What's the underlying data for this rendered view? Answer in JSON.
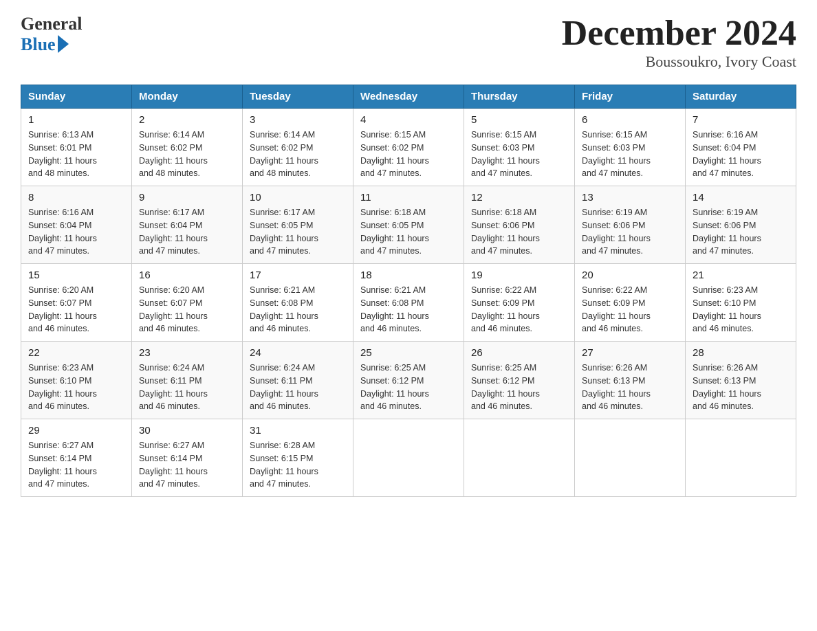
{
  "header": {
    "logo_general": "General",
    "logo_blue": "Blue",
    "month_title": "December 2024",
    "location": "Boussoukro, Ivory Coast"
  },
  "days_of_week": [
    "Sunday",
    "Monday",
    "Tuesday",
    "Wednesday",
    "Thursday",
    "Friday",
    "Saturday"
  ],
  "weeks": [
    [
      {
        "day": "1",
        "sunrise": "6:13 AM",
        "sunset": "6:01 PM",
        "daylight": "11 hours and 48 minutes."
      },
      {
        "day": "2",
        "sunrise": "6:14 AM",
        "sunset": "6:02 PM",
        "daylight": "11 hours and 48 minutes."
      },
      {
        "day": "3",
        "sunrise": "6:14 AM",
        "sunset": "6:02 PM",
        "daylight": "11 hours and 48 minutes."
      },
      {
        "day": "4",
        "sunrise": "6:15 AM",
        "sunset": "6:02 PM",
        "daylight": "11 hours and 47 minutes."
      },
      {
        "day": "5",
        "sunrise": "6:15 AM",
        "sunset": "6:03 PM",
        "daylight": "11 hours and 47 minutes."
      },
      {
        "day": "6",
        "sunrise": "6:15 AM",
        "sunset": "6:03 PM",
        "daylight": "11 hours and 47 minutes."
      },
      {
        "day": "7",
        "sunrise": "6:16 AM",
        "sunset": "6:04 PM",
        "daylight": "11 hours and 47 minutes."
      }
    ],
    [
      {
        "day": "8",
        "sunrise": "6:16 AM",
        "sunset": "6:04 PM",
        "daylight": "11 hours and 47 minutes."
      },
      {
        "day": "9",
        "sunrise": "6:17 AM",
        "sunset": "6:04 PM",
        "daylight": "11 hours and 47 minutes."
      },
      {
        "day": "10",
        "sunrise": "6:17 AM",
        "sunset": "6:05 PM",
        "daylight": "11 hours and 47 minutes."
      },
      {
        "day": "11",
        "sunrise": "6:18 AM",
        "sunset": "6:05 PM",
        "daylight": "11 hours and 47 minutes."
      },
      {
        "day": "12",
        "sunrise": "6:18 AM",
        "sunset": "6:06 PM",
        "daylight": "11 hours and 47 minutes."
      },
      {
        "day": "13",
        "sunrise": "6:19 AM",
        "sunset": "6:06 PM",
        "daylight": "11 hours and 47 minutes."
      },
      {
        "day": "14",
        "sunrise": "6:19 AM",
        "sunset": "6:06 PM",
        "daylight": "11 hours and 47 minutes."
      }
    ],
    [
      {
        "day": "15",
        "sunrise": "6:20 AM",
        "sunset": "6:07 PM",
        "daylight": "11 hours and 46 minutes."
      },
      {
        "day": "16",
        "sunrise": "6:20 AM",
        "sunset": "6:07 PM",
        "daylight": "11 hours and 46 minutes."
      },
      {
        "day": "17",
        "sunrise": "6:21 AM",
        "sunset": "6:08 PM",
        "daylight": "11 hours and 46 minutes."
      },
      {
        "day": "18",
        "sunrise": "6:21 AM",
        "sunset": "6:08 PM",
        "daylight": "11 hours and 46 minutes."
      },
      {
        "day": "19",
        "sunrise": "6:22 AM",
        "sunset": "6:09 PM",
        "daylight": "11 hours and 46 minutes."
      },
      {
        "day": "20",
        "sunrise": "6:22 AM",
        "sunset": "6:09 PM",
        "daylight": "11 hours and 46 minutes."
      },
      {
        "day": "21",
        "sunrise": "6:23 AM",
        "sunset": "6:10 PM",
        "daylight": "11 hours and 46 minutes."
      }
    ],
    [
      {
        "day": "22",
        "sunrise": "6:23 AM",
        "sunset": "6:10 PM",
        "daylight": "11 hours and 46 minutes."
      },
      {
        "day": "23",
        "sunrise": "6:24 AM",
        "sunset": "6:11 PM",
        "daylight": "11 hours and 46 minutes."
      },
      {
        "day": "24",
        "sunrise": "6:24 AM",
        "sunset": "6:11 PM",
        "daylight": "11 hours and 46 minutes."
      },
      {
        "day": "25",
        "sunrise": "6:25 AM",
        "sunset": "6:12 PM",
        "daylight": "11 hours and 46 minutes."
      },
      {
        "day": "26",
        "sunrise": "6:25 AM",
        "sunset": "6:12 PM",
        "daylight": "11 hours and 46 minutes."
      },
      {
        "day": "27",
        "sunrise": "6:26 AM",
        "sunset": "6:13 PM",
        "daylight": "11 hours and 46 minutes."
      },
      {
        "day": "28",
        "sunrise": "6:26 AM",
        "sunset": "6:13 PM",
        "daylight": "11 hours and 46 minutes."
      }
    ],
    [
      {
        "day": "29",
        "sunrise": "6:27 AM",
        "sunset": "6:14 PM",
        "daylight": "11 hours and 47 minutes."
      },
      {
        "day": "30",
        "sunrise": "6:27 AM",
        "sunset": "6:14 PM",
        "daylight": "11 hours and 47 minutes."
      },
      {
        "day": "31",
        "sunrise": "6:28 AM",
        "sunset": "6:15 PM",
        "daylight": "11 hours and 47 minutes."
      },
      null,
      null,
      null,
      null
    ]
  ],
  "labels": {
    "sunrise": "Sunrise:",
    "sunset": "Sunset:",
    "daylight": "Daylight:"
  }
}
